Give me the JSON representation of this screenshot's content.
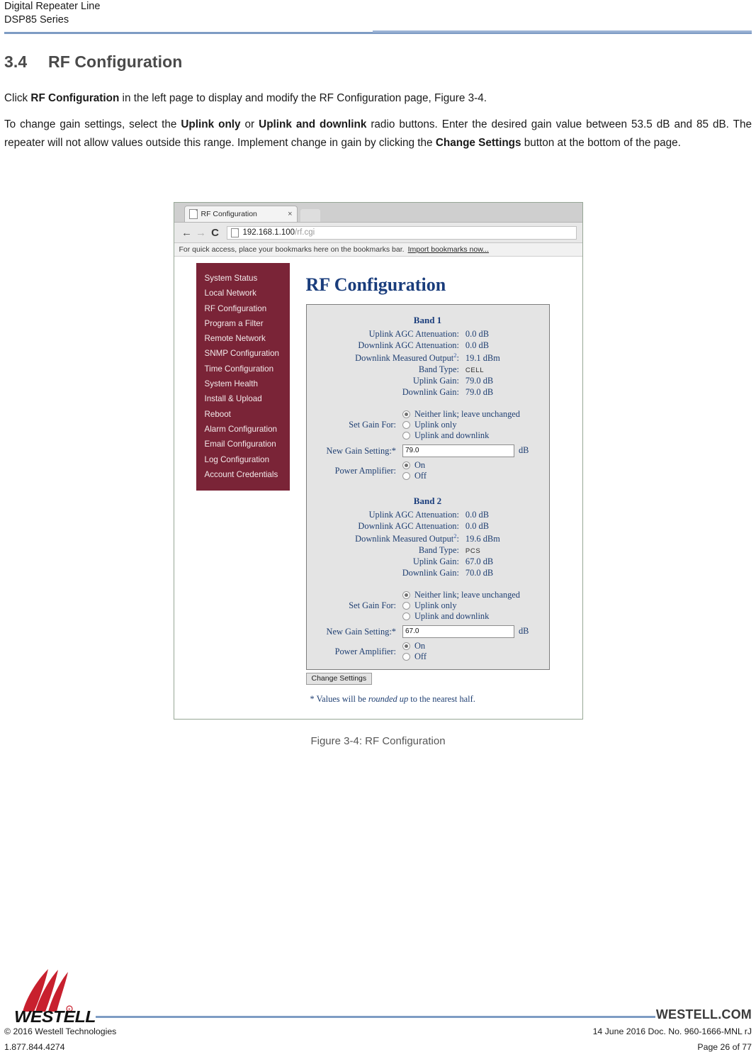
{
  "header": {
    "line1": "Digital Repeater Line",
    "line2": "DSP85 Series",
    "rule_color": "#7e9cc4"
  },
  "section": {
    "number": "3.4",
    "title": "RF Configuration",
    "paragraph1": {
      "part1": "Click ",
      "bold1": "RF Configuration",
      "part2": " in the left page to display and modify the RF Configuration page, Figure 3-4."
    },
    "paragraph2": {
      "part1": "To change gain settings, select the ",
      "bold1": "Uplink only",
      "part2": " or ",
      "bold2": "Uplink and downlink",
      "part3": " radio buttons. Enter the desired gain value between 53.5 dB and 85 dB.  The repeater will not allow values outside this range.  Implement change in gain by clicking the ",
      "bold3": "Change Settings",
      "part4": " button at the bottom of the page."
    }
  },
  "figure": {
    "caption": "Figure 3-4: RF Configuration",
    "browser": {
      "tab_title": "RF Configuration",
      "tab_close": "×",
      "back_icon": "←",
      "forward_icon": "→",
      "reload_icon": "C",
      "url_host": "192.168.1.100",
      "url_path": "/rf.cgi",
      "bookmark_text": "For quick access, place your bookmarks here on the bookmarks bar.",
      "bookmark_link": "Import bookmarks now..."
    },
    "sidebar": {
      "bg_color": "#7a2437",
      "items": [
        {
          "label": "System Status"
        },
        {
          "label": "Local Network"
        },
        {
          "label": "RF Configuration"
        },
        {
          "label": "Program a Filter"
        },
        {
          "label": "Remote Network"
        },
        {
          "label": "SNMP Configuration"
        },
        {
          "label": "Time Configuration"
        },
        {
          "label": "System Health"
        },
        {
          "label": "Install & Upload"
        },
        {
          "label": "Reboot"
        },
        {
          "label": "Alarm Configuration"
        },
        {
          "label": "Email Configuration"
        },
        {
          "label": "Log Configuration"
        },
        {
          "label": "Account Credentials"
        }
      ]
    },
    "page": {
      "title": "RF Configuration",
      "title_color": "#1a3d7c",
      "labels": {
        "uplink_agc": "Uplink AGC Attenuation:",
        "downlink_agc": "Downlink AGC Attenuation:",
        "downlink_measured": "Downlink Measured Output",
        "downlink_measured_fn": "2",
        "downlink_measured_colon": ":",
        "band_type": "Band Type:",
        "uplink_gain": "Uplink Gain:",
        "downlink_gain": "Downlink Gain:",
        "set_gain_for": "Set Gain For:",
        "new_gain_setting": "New Gain Setting:*",
        "power_amplifier": "Power Amplifier:",
        "unit_db": "dB",
        "opt_neither": "Neither link; leave unchanged",
        "opt_uplink_only": "Uplink only",
        "opt_uplink_and_downlink": "Uplink and downlink",
        "opt_on": "On",
        "opt_off": "Off"
      },
      "band1": {
        "title": "Band 1",
        "uplink_agc": "0.0 dB",
        "downlink_agc": "0.0 dB",
        "downlink_measured": "19.1 dBm",
        "band_type": "CELL",
        "uplink_gain": "79.0 dB",
        "downlink_gain": "79.0 dB",
        "set_gain_selected": "Neither link; leave unchanged",
        "new_gain_value": "79.0",
        "power_amplifier_selected": "On"
      },
      "band2": {
        "title": "Band 2",
        "uplink_agc": "0.0 dB",
        "downlink_agc": "0.0 dB",
        "downlink_measured": "19.6 dBm",
        "band_type": "PCS",
        "uplink_gain": "67.0 dB",
        "downlink_gain": "70.0 dB",
        "set_gain_selected": "Neither link; leave unchanged",
        "new_gain_value": "67.0",
        "power_amplifier_selected": "On"
      },
      "change_settings_button": "Change Settings",
      "footnote": {
        "part1": "* Values will be ",
        "italic": "rounded up",
        "part2": " to the nearest half."
      }
    }
  },
  "footer": {
    "brand": "WESTELL",
    "website": "WESTELL.COM",
    "copyright": "© 2016 Westell Technologies",
    "phone": "1.877.844.4274",
    "doc_info": "14 June 2016 Doc. No. 960-1666-MNL rJ",
    "page_info": "Page 26 of 77",
    "logo_color": "#c8202e"
  }
}
